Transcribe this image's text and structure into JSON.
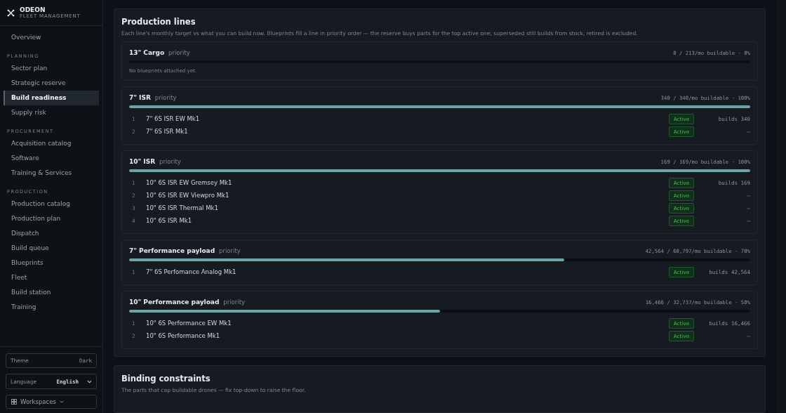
{
  "brand": {
    "name": "ODEON",
    "subtitle": "FLEET MANAGEMENT"
  },
  "sidebar": {
    "sections": [
      {
        "items": [
          {
            "label": "Overview",
            "selected": false
          }
        ]
      },
      {
        "heading": "PLANNING",
        "items": [
          {
            "label": "Sector plan",
            "selected": false
          },
          {
            "label": "Strategic reserve",
            "selected": false
          },
          {
            "label": "Build readiness",
            "selected": true
          },
          {
            "label": "Supply risk",
            "selected": false
          }
        ]
      },
      {
        "heading": "PROCUREMENT",
        "items": [
          {
            "label": "Acquisition catalog",
            "selected": false
          },
          {
            "label": "Software",
            "selected": false
          },
          {
            "label": "Training & Services",
            "selected": false
          }
        ]
      },
      {
        "heading": "PRODUCTION",
        "items": [
          {
            "label": "Production catalog",
            "selected": false
          },
          {
            "label": "Production plan",
            "selected": false
          },
          {
            "label": "Dispatch",
            "selected": false
          },
          {
            "label": "Build queue",
            "selected": false
          },
          {
            "label": "Blueprints",
            "selected": false
          },
          {
            "label": "Fleet",
            "selected": false
          },
          {
            "label": "Build station",
            "selected": false
          },
          {
            "label": "Training",
            "selected": false
          }
        ]
      }
    ],
    "theme": {
      "label": "Theme",
      "value": "Dark"
    },
    "language": {
      "label": "Language",
      "value": "English"
    },
    "workspaces": "Workspaces"
  },
  "production_lines": {
    "title": "Production lines",
    "subtitle": "Each line's monthly target vs what you can build now. Blueprints fill a line in priority order — the reserve buys parts for the top active one; superseded still builds from stock, retired is excluded.",
    "lines": [
      {
        "name": "13\" Cargo",
        "tag": "priority",
        "stat": "0 / 213/mo buildable · 0%",
        "level": 0,
        "empty_note": "No blueprints attached yet."
      },
      {
        "name": "7\" ISR",
        "tag": "priority",
        "stat": "340 / 340/mo buildable · 100%",
        "level": 1,
        "blueprints": [
          {
            "index": "1",
            "name": "7\" 6S ISR EW Mk1",
            "status": "Active",
            "builds": "builds 340"
          },
          {
            "index": "2",
            "name": "7\" 6S ISR Mk1",
            "status": "Active",
            "builds": "–"
          }
        ]
      },
      {
        "name": "10\" ISR",
        "tag": "priority",
        "stat": "169 / 169/mo buildable · 100%",
        "level": 1,
        "blueprints": [
          {
            "index": "1",
            "name": "10\" 6S ISR EW Gremsey Mk1",
            "status": "Active",
            "builds": "builds 169"
          },
          {
            "index": "2",
            "name": "10\" 6S ISR EW Viewpro Mk1",
            "status": "Active",
            "builds": "–"
          },
          {
            "index": "3",
            "name": "10\" 6S ISR Thermal Mk1",
            "status": "Active",
            "builds": "–"
          },
          {
            "index": "4",
            "name": "10\" 6S ISR Mk1",
            "status": "Active",
            "builds": "–"
          }
        ]
      },
      {
        "name": "7\" Performance payload",
        "tag": "priority",
        "stat": "42,564 / 60,797/mo buildable · 70%",
        "level": 0.7,
        "blueprints": [
          {
            "index": "1",
            "name": "7\" 6S Perfomance Analog Mk1",
            "status": "Active",
            "builds": "builds 42,564"
          }
        ]
      },
      {
        "name": "10\" Performance payload",
        "tag": "priority",
        "stat": "16,466 / 32,737/mo buildable · 50%",
        "level": 0.5,
        "blueprints": [
          {
            "index": "1",
            "name": "10\" 6S Performance EW Mk1",
            "status": "Active",
            "builds": "builds 16,466"
          },
          {
            "index": "2",
            "name": "10\" 6S Performance Mk1",
            "status": "Active",
            "builds": "–"
          }
        ]
      }
    ]
  },
  "binding_constraints": {
    "title": "Binding constraints",
    "subtitle": "The parts that cap buildable drones — fix top-down to raise the floor."
  }
}
